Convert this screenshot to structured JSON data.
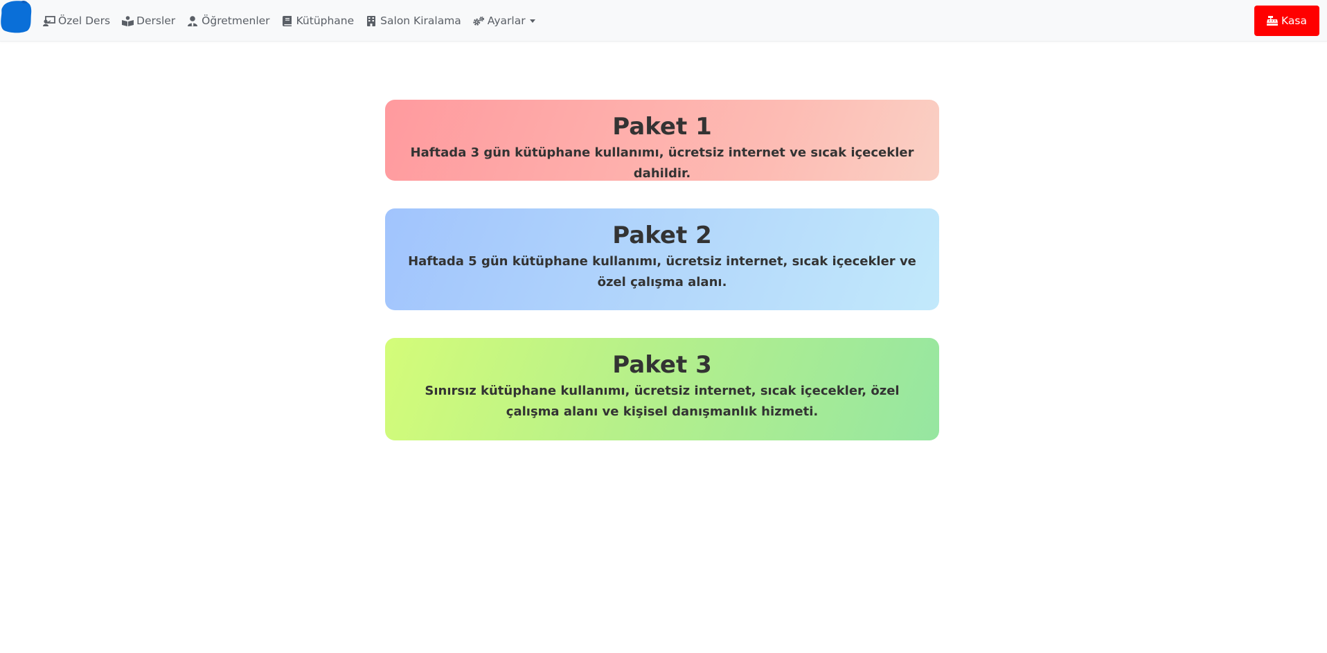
{
  "nav": {
    "items": [
      {
        "label": "Özel Ders",
        "icon": "chalkboard-teacher-icon"
      },
      {
        "label": "Dersler",
        "icon": "book-reader-icon"
      },
      {
        "label": "Öğretmenler",
        "icon": "user-tie-icon"
      },
      {
        "label": "Kütüphane",
        "icon": "book-icon"
      },
      {
        "label": "Salon Kiralama",
        "icon": "building-icon"
      },
      {
        "label": "Ayarlar",
        "icon": "cogs-icon"
      }
    ],
    "kasa_label": "Kasa",
    "kasa_icon": "cash-register-icon",
    "kasa_color": "#ff0000",
    "logo_color": "#0a6fd8"
  },
  "packages": [
    {
      "title": "Paket 1",
      "description": "Haftada 3 gün kütüphane kullanımı, ücretsiz internet ve sıcak içecekler dahildir."
    },
    {
      "title": "Paket 2",
      "description": "Haftada 5 gün kütüphane kullanımı, ücretsiz internet, sıcak içecekler ve özel çalışma alanı."
    },
    {
      "title": "Paket 3",
      "description": "Sınırsız kütüphane kullanımı, ücretsiz internet, sıcak içecekler, özel çalışma alanı ve kişisel danışmanlık hizmeti."
    }
  ]
}
